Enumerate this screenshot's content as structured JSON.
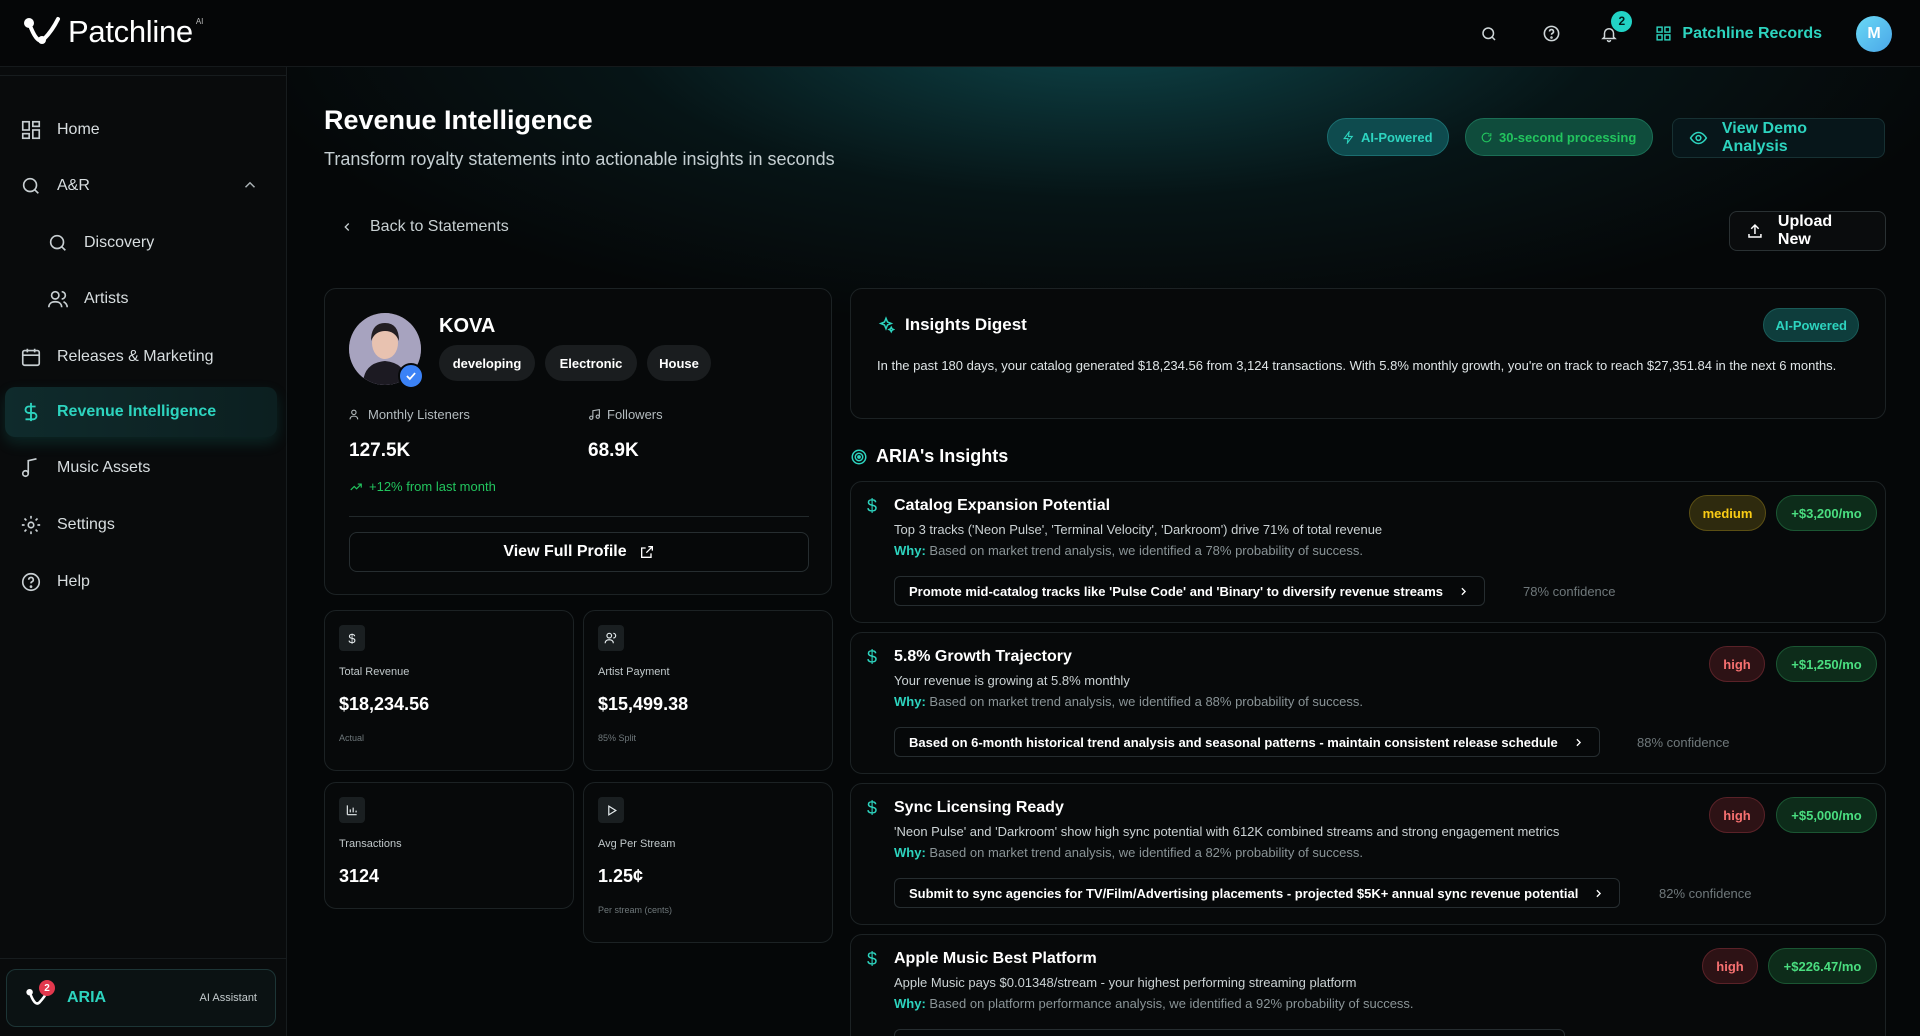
{
  "app": {
    "logo_text": "Patchline",
    "logo_superscript": "AI",
    "org_name": "Patchline Records",
    "avatar_initial": "M",
    "notification_count": "2"
  },
  "sidebar": {
    "items": [
      {
        "label": "Home",
        "icon": "grid-icon"
      },
      {
        "label": "A&R",
        "icon": "search-icon"
      },
      {
        "label": "Discovery",
        "icon": "search-icon"
      },
      {
        "label": "Artists",
        "icon": "users-icon"
      },
      {
        "label": "Releases & Marketing",
        "icon": "calendar-icon"
      },
      {
        "label": "Revenue Intelligence",
        "icon": "dollar-icon"
      },
      {
        "label": "Music Assets",
        "icon": "music-note-icon"
      },
      {
        "label": "Settings",
        "icon": "gear-icon"
      },
      {
        "label": "Help",
        "icon": "help-circle-icon"
      }
    ],
    "aria": {
      "label": "ARIA",
      "sublabel": "AI Assistant",
      "badge": "2"
    }
  },
  "header": {
    "title": "Revenue Intelligence",
    "subtitle": "Transform royalty statements into actionable insights in seconds",
    "pill_ai": "AI-Powered",
    "pill_processing": "30-second processing",
    "demo_button": "View Demo Analysis",
    "back_link": "Back to Statements",
    "upload_button": "Upload New"
  },
  "artist": {
    "name": "KOVA",
    "tags": [
      "developing",
      "Electronic",
      "House"
    ],
    "listeners_label": "Monthly Listeners",
    "listeners_value": "127.5K",
    "followers_label": "Followers",
    "followers_value": "68.9K",
    "growth": "+12% from last month",
    "profile_button": "View Full Profile"
  },
  "metrics": [
    {
      "icon": "dollar-icon",
      "label": "Total Revenue",
      "value": "$18,234.56",
      "note": "Actual"
    },
    {
      "icon": "users-icon",
      "label": "Artist Payment",
      "value": "$15,499.38",
      "note": "85% Split"
    },
    {
      "icon": "bar-chart-icon",
      "label": "Transactions",
      "value": "3124",
      "note": ""
    },
    {
      "icon": "play-icon",
      "label": "Avg Per Stream",
      "value": "1.25¢",
      "note": "Per stream (cents)"
    }
  ],
  "digest": {
    "title": "Insights Digest",
    "badge": "AI-Powered",
    "text": "In the past 180 days, your catalog generated $18,234.56 from 3,124 transactions. With 5.8% monthly growth, you're on track to reach $27,351.84 in the next 6 months."
  },
  "aria_insights": {
    "heading": "ARIA's Insights",
    "why_label": "Why:",
    "items": [
      {
        "title": "Catalog Expansion Potential",
        "desc": "Top 3 tracks ('Neon Pulse', 'Terminal Velocity', 'Darkroom') drive 71% of total revenue",
        "why": "Based on market trend analysis, we identified a 78% probability of success.",
        "action": "Promote mid-catalog tracks like 'Pulse Code' and 'Binary' to diversify revenue streams",
        "confidence": "78% confidence",
        "priority": "medium",
        "impact": "+$3,200/mo"
      },
      {
        "title": "5.8% Growth Trajectory",
        "desc": "Your revenue is growing at 5.8% monthly",
        "why": "Based on market trend analysis, we identified a 88% probability of success.",
        "action": "Based on 6-month historical trend analysis and seasonal patterns - maintain consistent release schedule",
        "confidence": "88% confidence",
        "priority": "high",
        "impact": "+$1,250/mo"
      },
      {
        "title": "Sync Licensing Ready",
        "desc": "'Neon Pulse' and 'Darkroom' show high sync potential with 612K combined streams and strong engagement metrics",
        "why": "Based on market trend analysis, we identified a 82% probability of success.",
        "action": "Submit to sync agencies for TV/Film/Advertising placements - projected $5K+ annual sync revenue potential",
        "confidence": "82% confidence",
        "priority": "high",
        "impact": "+$5,000/mo"
      },
      {
        "title": "Apple Music Best Platform",
        "desc": "Apple Music pays $0.01348/stream - your highest performing streaming platform",
        "why": "Based on platform performance analysis, we identified a 92% probability of success.",
        "action": "",
        "confidence": "",
        "priority": "high",
        "impact": "+$226.47/mo"
      }
    ]
  }
}
